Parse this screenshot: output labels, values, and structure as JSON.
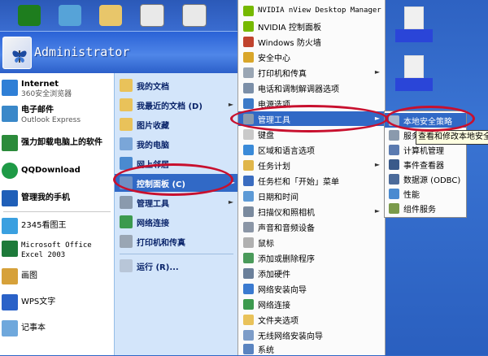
{
  "user": {
    "name": "Administrator"
  },
  "left_items": [
    {
      "title": "Internet",
      "subtitle": "360安全浏览器",
      "icon": "ie-icon"
    },
    {
      "title": "电子邮件",
      "subtitle": "Outlook Express",
      "icon": "email-icon"
    },
    {
      "title": "强力卸载电脑上的软件",
      "subtitle": "",
      "icon": "uninstall-icon"
    },
    {
      "title": "QQDownload",
      "subtitle": "",
      "icon": "qqdownload-icon"
    },
    {
      "title": "管理我的手机",
      "subtitle": "",
      "icon": "phone-icon"
    },
    {
      "title": "2345看图王",
      "subtitle": "",
      "icon": "image-viewer-icon"
    },
    {
      "title": "Microsoft Office Excel 2003",
      "subtitle": "",
      "icon": "excel-icon"
    },
    {
      "title": "画图",
      "subtitle": "",
      "icon": "paint-icon"
    },
    {
      "title": "WPS文字",
      "subtitle": "",
      "icon": "wps-icon"
    },
    {
      "title": "记事本",
      "subtitle": "",
      "icon": "notepad-icon"
    }
  ],
  "right_items": [
    {
      "label": "我的文档",
      "icon": "documents-icon"
    },
    {
      "label": "我最近的文档 (D)",
      "icon": "recent-docs-icon",
      "arrow": true
    },
    {
      "label": "图片收藏",
      "icon": "pictures-icon"
    },
    {
      "label": "我的电脑",
      "icon": "my-computer-icon"
    },
    {
      "label": "网上邻居",
      "icon": "network-places-icon"
    },
    {
      "label": "控制面板 (C)",
      "icon": "control-panel-icon",
      "arrow": true,
      "highlighted": true
    },
    {
      "label": "管理工具",
      "icon": "admin-tools-icon",
      "arrow": true
    },
    {
      "label": "网络连接",
      "icon": "network-icon"
    },
    {
      "label": "打印机和传真",
      "icon": "printer-icon"
    },
    {
      "label": "运行 (R)...",
      "icon": "run-icon"
    }
  ],
  "control_panel_items": [
    {
      "label": "NVIDIA nView Desktop Manager",
      "icon": "nvidia-icon"
    },
    {
      "label": "NVIDIA 控制面板",
      "icon": "nvidia-icon"
    },
    {
      "label": "Windows 防火墙",
      "icon": "firewall-icon"
    },
    {
      "label": "安全中心",
      "icon": "security-center-icon"
    },
    {
      "label": "打印机和传真",
      "icon": "printer-icon",
      "arrow": true
    },
    {
      "label": "电话和调制解调器选项",
      "icon": "phone-modem-icon"
    },
    {
      "label": "电源选项",
      "icon": "power-icon"
    },
    {
      "label": "管理工具",
      "icon": "admin-tools-icon",
      "arrow": true,
      "highlighted": true
    },
    {
      "label": "键盘",
      "icon": "keyboard-icon"
    },
    {
      "label": "区域和语言选项",
      "icon": "region-icon"
    },
    {
      "label": "任务计划",
      "icon": "task-scheduler-icon",
      "arrow": true
    },
    {
      "label": "任务栏和「开始」菜单",
      "icon": "taskbar-icon"
    },
    {
      "label": "日期和时间",
      "icon": "date-time-icon"
    },
    {
      "label": "扫描仪和照相机",
      "icon": "scanner-icon",
      "arrow": true
    },
    {
      "label": "声音和音频设备",
      "icon": "sound-icon"
    },
    {
      "label": "鼠标",
      "icon": "mouse-icon"
    },
    {
      "label": "添加或删除程序",
      "icon": "add-remove-icon"
    },
    {
      "label": "添加硬件",
      "icon": "add-hardware-icon"
    },
    {
      "label": "网络安装向导",
      "icon": "network-wizard-icon"
    },
    {
      "label": "网络连接",
      "icon": "network-icon"
    },
    {
      "label": "文件夹选项",
      "icon": "folder-options-icon"
    },
    {
      "label": "无线网络安装向导",
      "icon": "wireless-icon"
    },
    {
      "label": "系统",
      "icon": "system-icon"
    }
  ],
  "admin_tools_items": [
    {
      "label": "本地安全策略",
      "icon": "local-security-icon",
      "highlighted": true
    },
    {
      "label": "服务",
      "icon": "services-icon"
    },
    {
      "label": "计算机管理",
      "icon": "computer-management-icon"
    },
    {
      "label": "事件查看器",
      "icon": "event-viewer-icon"
    },
    {
      "label": "数据源 (ODBC)",
      "icon": "odbc-icon"
    },
    {
      "label": "性能",
      "icon": "performance-icon"
    },
    {
      "label": "组件服务",
      "icon": "component-services-icon"
    }
  ],
  "tooltip": {
    "text": "查看和修改本地安全"
  },
  "colors": {
    "highlight": "#3169c6",
    "annotation_ring": "#c8102e",
    "start_menu_blue": "#2a62d6"
  }
}
